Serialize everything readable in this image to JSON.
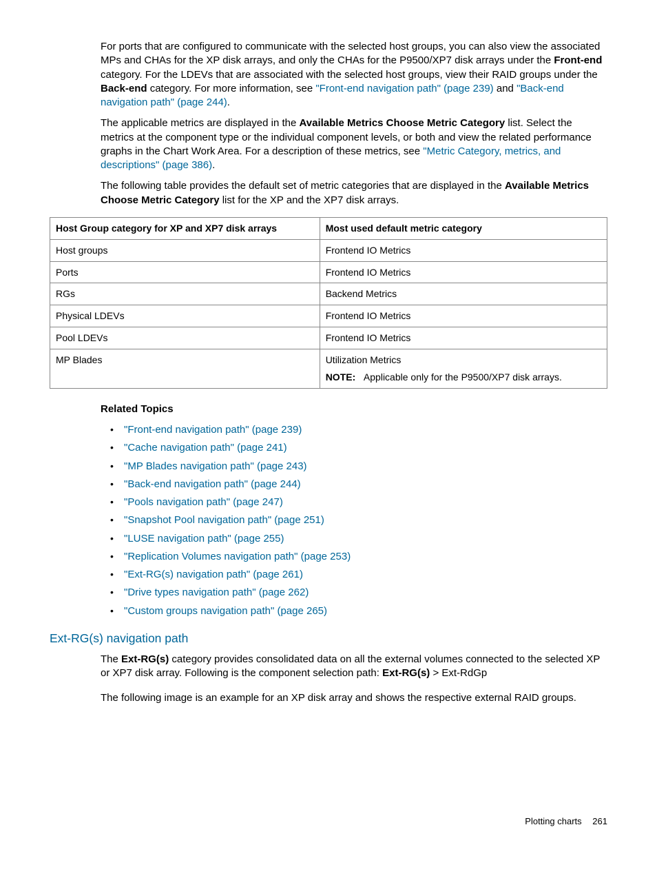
{
  "para1": {
    "t1": "For ports that are configured to communicate with the selected host groups, you can also view the associated MPs and CHAs for the XP disk arrays, and only the CHAs for the P9500/XP7 disk arrays under the ",
    "b1": "Front-end",
    "t2": " category. For the LDEVs that are associated with the selected host groups, view their RAID groups under the ",
    "b2": "Back-end",
    "t3": " category. For more information, see ",
    "l1": "\"Front-end navigation path\" (page 239)",
    "t4": " and ",
    "l2": "\"Back-end navigation path\" (page 244)",
    "t5": "."
  },
  "para2": {
    "t1": "The applicable metrics are displayed in the ",
    "b1": "Available Metrics Choose Metric Category",
    "t2": " list. Select the metrics at the component type or the individual component levels, or both and view the related performance graphs in the Chart Work Area. For a description of these metrics, see ",
    "l1": "\"Metric Category, metrics, and descriptions\" (page 386)",
    "t3": "."
  },
  "para3": {
    "t1": "The following table provides the default set of metric categories that are displayed in the ",
    "b1": "Available Metrics Choose Metric Category",
    "t2": " list for the XP and the XP7 disk arrays."
  },
  "table": {
    "h1": "Host Group category for XP and XP7 disk arrays",
    "h2": "Most used default metric category",
    "r1c1": "Host groups",
    "r1c2": "Frontend IO Metrics",
    "r2c1": "Ports",
    "r2c2": "Frontend IO Metrics",
    "r3c1": "RGs",
    "r3c2": "Backend Metrics",
    "r4c1": "Physical LDEVs",
    "r4c2": "Frontend IO Metrics",
    "r5c1": "Pool LDEVs",
    "r5c2": "Frontend IO Metrics",
    "r6c1": "MP Blades",
    "r6c2a": "Utilization Metrics",
    "r6note_label": "NOTE:",
    "r6note_text": "Applicable only for the P9500/XP7 disk arrays."
  },
  "related_heading": "Related Topics",
  "related": [
    "\"Front-end navigation path\" (page 239)",
    "\"Cache navigation path\" (page 241)",
    "\"MP Blades navigation path\" (page 243)",
    "\"Back-end navigation path\" (page 244)",
    "\"Pools navigation path\" (page 247)",
    "\"Snapshot Pool navigation path\" (page 251)",
    "\"LUSE navigation path\" (page 255)",
    "\"Replication Volumes navigation path\" (page 253)",
    "\"Ext-RG(s) navigation path\" (page 261)",
    "\"Drive types navigation path\" (page 262)",
    "\"Custom groups navigation path\" (page 265)"
  ],
  "section_heading": "Ext-RG(s) navigation path",
  "para4": {
    "t1": "The ",
    "b1": "Ext-RG(s)",
    "t2": " category provides consolidated data on all the external volumes connected to the selected XP or XP7 disk array. Following is the component selection path: ",
    "b2": "Ext-RG(s)",
    "t3": " > Ext-RdGp"
  },
  "para5": "The following image is an example for an XP disk array and shows the respective external RAID groups.",
  "footer": {
    "label": "Plotting charts",
    "page": "261"
  }
}
